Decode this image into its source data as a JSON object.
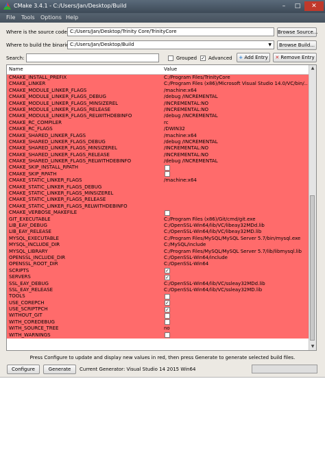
{
  "window": {
    "title": "CMake 3.4.1 - C:/Users/Jan/Desktop/Build",
    "minimize": "–",
    "maximize": "□",
    "close": "✕"
  },
  "menu": {
    "file": "File",
    "tools": "Tools",
    "options": "Options",
    "help": "Help"
  },
  "source": {
    "label": "Where is the source code:",
    "value": "C:/Users/Jan/Desktop/Trinity Core/TrinityCore",
    "browse": "Browse Source..."
  },
  "build": {
    "label": "Where to build the binaries:",
    "value": "C:/Users/Jan/Desktop/Build",
    "browse": "Browse Build..."
  },
  "search": {
    "label": "Search:",
    "value": ""
  },
  "options": {
    "grouped": "Grouped",
    "grouped_checked": false,
    "advanced": "Advanced",
    "advanced_checked": true,
    "add_entry": "Add Entry",
    "remove_entry": "Remove Entry"
  },
  "table": {
    "col_name": "Name",
    "col_value": "Value",
    "rows": [
      {
        "name": "CMAKE_INSTALL_PREFIX",
        "value": "C:/Program Files/TrinityCore"
      },
      {
        "name": "CMAKE_LINKER",
        "value": "C:/Program Files (x86)/Microsoft Visual Studio 14.0/VC/bin/..."
      },
      {
        "name": "CMAKE_MODULE_LINKER_FLAGS",
        "value": "/machine:x64"
      },
      {
        "name": "CMAKE_MODULE_LINKER_FLAGS_DEBUG",
        "value": "/debug /INCREMENTAL"
      },
      {
        "name": "CMAKE_MODULE_LINKER_FLAGS_MINSIZEREL",
        "value": "/INCREMENTAL:NO"
      },
      {
        "name": "CMAKE_MODULE_LINKER_FLAGS_RELEASE",
        "value": "/INCREMENTAL:NO"
      },
      {
        "name": "CMAKE_MODULE_LINKER_FLAGS_RELWITHDEBINFO",
        "value": "/debug /INCREMENTAL"
      },
      {
        "name": "CMAKE_RC_COMPILER",
        "value": "rc"
      },
      {
        "name": "CMAKE_RC_FLAGS",
        "value": " /DWIN32"
      },
      {
        "name": "CMAKE_SHARED_LINKER_FLAGS",
        "value": " /machine:x64"
      },
      {
        "name": "CMAKE_SHARED_LINKER_FLAGS_DEBUG",
        "value": "/debug /INCREMENTAL"
      },
      {
        "name": "CMAKE_SHARED_LINKER_FLAGS_MINSIZEREL",
        "value": "/INCREMENTAL:NO"
      },
      {
        "name": "CMAKE_SHARED_LINKER_FLAGS_RELEASE",
        "value": "/INCREMENTAL:NO"
      },
      {
        "name": "CMAKE_SHARED_LINKER_FLAGS_RELWITHDEBINFO",
        "value": "/debug /INCREMENTAL"
      },
      {
        "name": "CMAKE_SKIP_INSTALL_RPATH",
        "checkbox": true,
        "checked": false
      },
      {
        "name": "CMAKE_SKIP_RPATH",
        "checkbox": true,
        "checked": false
      },
      {
        "name": "CMAKE_STATIC_LINKER_FLAGS",
        "value": " /machine:x64"
      },
      {
        "name": "CMAKE_STATIC_LINKER_FLAGS_DEBUG",
        "value": ""
      },
      {
        "name": "CMAKE_STATIC_LINKER_FLAGS_MINSIZEREL",
        "value": ""
      },
      {
        "name": "CMAKE_STATIC_LINKER_FLAGS_RELEASE",
        "value": ""
      },
      {
        "name": "CMAKE_STATIC_LINKER_FLAGS_RELWITHDEBINFO",
        "value": ""
      },
      {
        "name": "CMAKE_VERBOSE_MAKEFILE",
        "checkbox": true,
        "checked": false
      },
      {
        "name": "GIT_EXECUTABLE",
        "value": "C:/Program Files (x86)/Git/cmd/git.exe"
      },
      {
        "name": "LIB_EAY_DEBUG",
        "value": "C:/OpenSSL-Win64/lib/VC/libeay32MDd.lib"
      },
      {
        "name": "LIB_EAY_RELEASE",
        "value": "C:/OpenSSL-Win64/lib/VC/libeay32MD.lib"
      },
      {
        "name": "MYSQL_EXECUTABLE",
        "value": "C:/Program Files/MySQL/MySQL Server 5.7/bin/mysql.exe"
      },
      {
        "name": "MYSQL_INCLUDE_DIR",
        "value": "C:/MySQL/include"
      },
      {
        "name": "MYSQL_LIBRARY",
        "value": "C:/Program Files/MySQL/MySQL Server 5.7/lib/libmysql.lib"
      },
      {
        "name": "OPENSSL_INCLUDE_DIR",
        "value": "C:/OpenSSL-Win64/include"
      },
      {
        "name": "OPENSSL_ROOT_DIR",
        "value": "C:/OpenSSL-Win64"
      },
      {
        "name": "SCRIPTS",
        "checkbox": true,
        "checked": true
      },
      {
        "name": "SERVERS",
        "checkbox": true,
        "checked": true
      },
      {
        "name": "SSL_EAY_DEBUG",
        "value": "C:/OpenSSL-Win64/lib/VC/ssleay32MDd.lib"
      },
      {
        "name": "SSL_EAY_RELEASE",
        "value": "C:/OpenSSL-Win64/lib/VC/ssleay32MD.lib"
      },
      {
        "name": "TOOLS",
        "checkbox": true,
        "checked": false
      },
      {
        "name": "USE_COREPCH",
        "checkbox": true,
        "checked": true
      },
      {
        "name": "USE_SCRIPTPCH",
        "checkbox": true,
        "checked": true
      },
      {
        "name": "WITHOUT_GIT",
        "checkbox": true,
        "checked": false
      },
      {
        "name": "WITH_COREDEBUG",
        "checkbox": true,
        "checked": false
      },
      {
        "name": "WITH_SOURCE_TREE",
        "value": "no"
      },
      {
        "name": "WITH_WARNINGS",
        "checkbox": true,
        "checked": false
      }
    ]
  },
  "hint": "Press Configure to update and display new values in red, then press Generate to generate selected build files.",
  "bottom": {
    "configure": "Configure",
    "generate": "Generate",
    "generator": "Current Generator: Visual Studio 14 2015 Win64"
  },
  "colors": {
    "changed_row": "#ff6b6b",
    "titlebar": "#4a5866"
  }
}
